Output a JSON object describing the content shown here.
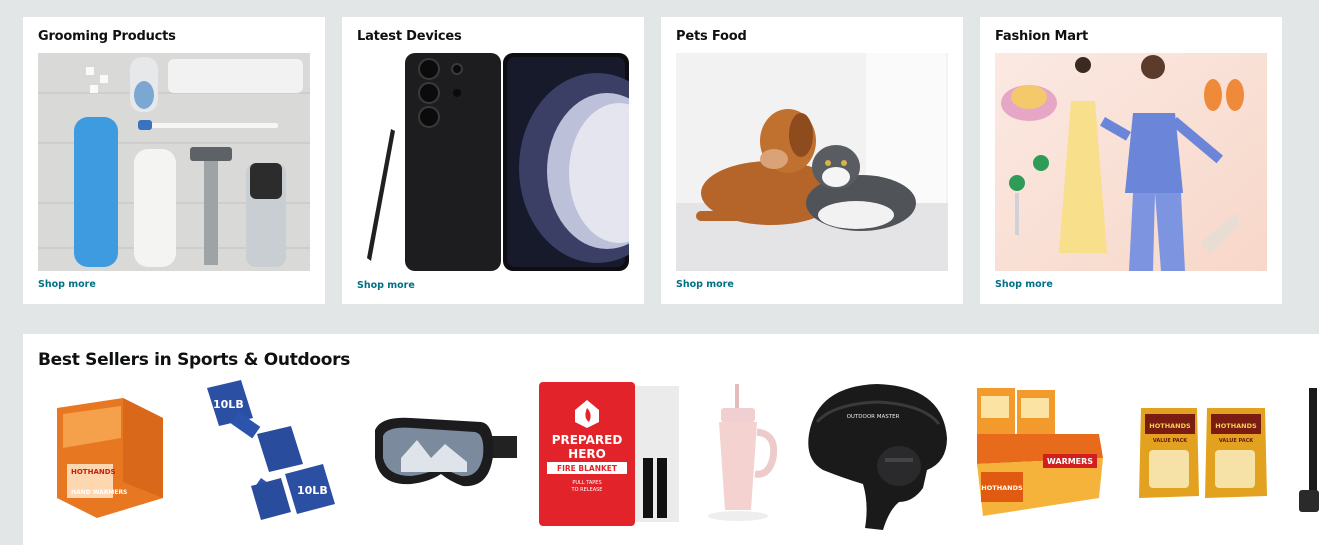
{
  "cards": [
    {
      "title": "Grooming Products",
      "link": "Shop more",
      "image": "grooming-products-photo"
    },
    {
      "title": "Latest Devices",
      "link": "Shop more",
      "image": "smartphone-with-stylus-photo"
    },
    {
      "title": "Pets Food",
      "link": "Shop more",
      "image": "dog-and-cat-photo"
    },
    {
      "title": "Fashion Mart",
      "link": "Shop more",
      "image": "fashion-models-accessories-photo"
    }
  ],
  "bestsellers": {
    "title": "Best Sellers in Sports & Outdoors",
    "products": [
      {
        "image": "hand-warmers-display-box",
        "text": [
          "HOTHANDS",
          "HAND WARMERS"
        ]
      },
      {
        "image": "blue-dumbbells",
        "text": [
          "10LB",
          "10LB"
        ]
      },
      {
        "image": "ski-goggles"
      },
      {
        "image": "fire-blanket",
        "text": [
          "PREPARED",
          "HERO",
          "FIRE BLANKET",
          "PULL TAPES",
          "TO RELEASE"
        ]
      },
      {
        "image": "pink-tumbler"
      },
      {
        "image": "ski-helmet",
        "text": [
          "OUTDOOR MASTER"
        ]
      },
      {
        "image": "hand-warmer-value-box",
        "text": [
          "HOTHANDS",
          "WARMERS"
        ]
      },
      {
        "image": "hand-warmer-value-packs",
        "text": [
          "HOTHANDS",
          "VALUE PACK",
          "HOTHANDS",
          "VALUE PACK"
        ]
      },
      {
        "image": "partial-product"
      }
    ]
  },
  "colors": {
    "page_bg": "#e3e6e6",
    "link": "#007185",
    "text": "#0f1111"
  }
}
